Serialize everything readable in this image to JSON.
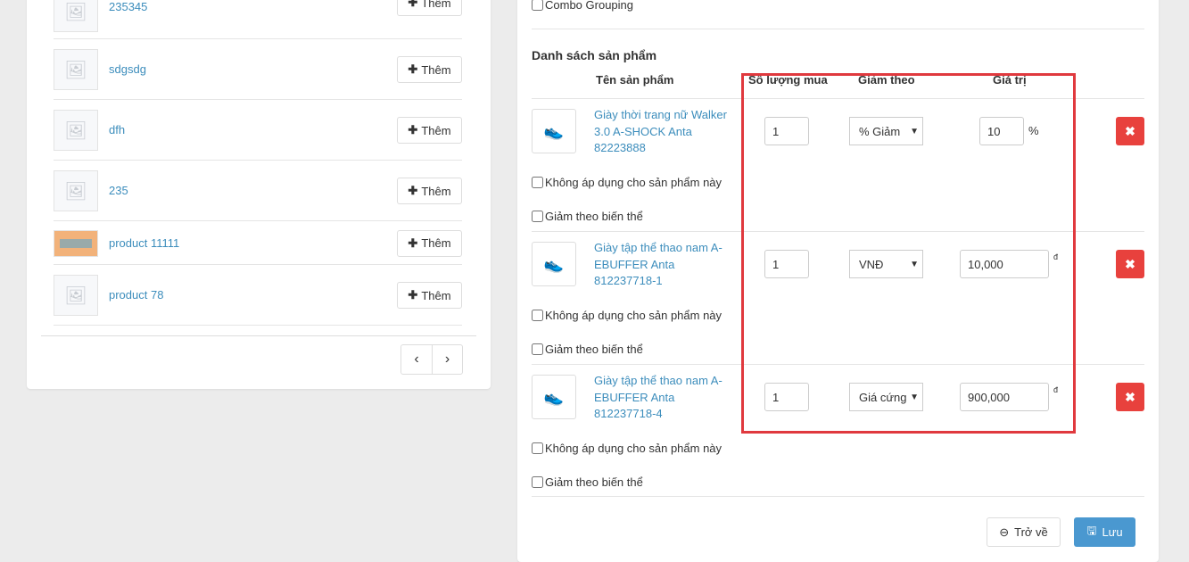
{
  "product_picker": {
    "add_label": "Thêm",
    "items": [
      {
        "name": "235345"
      },
      {
        "name": "sdgsdg"
      },
      {
        "name": "dfh"
      },
      {
        "name": "235"
      },
      {
        "name": "product 11111"
      },
      {
        "name": "product 78"
      }
    ],
    "prev": "‹",
    "next": "›"
  },
  "form": {
    "combo_grouping": "Combo Grouping",
    "section_title": "Danh sách sản phẩm",
    "columns": {
      "name": "Tên sản phẩm",
      "qty": "Số lượng mua",
      "discount_by": "Giảm theo",
      "value": "Giá trị"
    },
    "exclude_label": "Không áp dụng cho sản phẩm này",
    "variant_label": "Giảm theo biến thể",
    "rows": [
      {
        "name": "Giày thời trang nữ Walker 3.0 A-SHOCK Anta 82223888",
        "qty": "1",
        "discount_by": "% Giảm",
        "value": "10",
        "unit": "%"
      },
      {
        "name": "Giày tập thể thao nam A-EBUFFER Anta 812237718-1",
        "qty": "1",
        "discount_by": "VNĐ",
        "value": "10,000",
        "unit": "đ"
      },
      {
        "name": "Giày tập thể thao nam A-EBUFFER Anta 812237718-4",
        "qty": "1",
        "discount_by": "Giá cứng",
        "value": "900,000",
        "unit": "đ"
      }
    ],
    "back_label": "Trở về",
    "save_label": "Lưu"
  },
  "colors": {
    "accent": "#3c8dbc",
    "danger": "#e8413d",
    "highlight": "#e0393e"
  }
}
